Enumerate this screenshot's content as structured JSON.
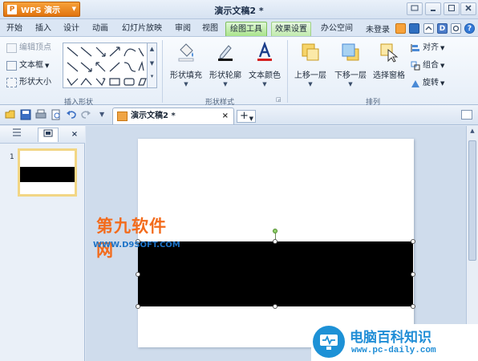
{
  "app": {
    "menu_button": "WPS 演示",
    "doc_title": "演示文稿2 *"
  },
  "tabs": [
    "开始",
    "插入",
    "设计",
    "动画",
    "幻灯片放映",
    "审阅",
    "视图",
    "绘图工具",
    "效果设置",
    "办公空间"
  ],
  "active_tab": "绘图工具",
  "account": "未登录",
  "ribbon": {
    "group_insert_shape": {
      "label": "插入形状",
      "edit_points": "编辑顶点",
      "text_box": "文本框",
      "shape_size": "形状大小"
    },
    "group_shape_style": {
      "label": "形状样式",
      "fill": "形状填充",
      "outline": "形状轮廓",
      "text_color": "文本颜色"
    },
    "group_arrange": {
      "label": "排列",
      "bring_forward": "上移一层",
      "send_backward": "下移一层",
      "selection_pane": "选择窗格",
      "align": "对齐",
      "group": "组合",
      "rotate": "旋转"
    }
  },
  "doc_tab": {
    "name": "演示文稿2 *",
    "close": "×",
    "new": "+"
  },
  "slides_panel": {
    "slide_number": "1",
    "close": "×"
  },
  "watermarks": {
    "site1_name": "第九软件网",
    "site1_url": "WWW.D9SOFT.COM",
    "site2_name": "电脑百科知识",
    "site2_url": "www.pc-daily.com"
  },
  "colors": {
    "accent_orange": "#f0891e",
    "tab_green": "#a9e38b",
    "slide_shape": "#000000"
  }
}
